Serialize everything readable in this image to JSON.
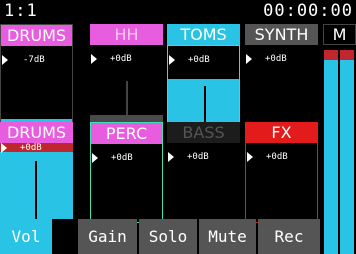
{
  "header": {
    "position": "1:1",
    "time": "00:00:00"
  },
  "tracks_row1": [
    {
      "name": "DRUMS",
      "color": "#e85ce0",
      "level": "-7dB",
      "fill_fraction": 0.0,
      "has_meter": true
    },
    {
      "name": "HH",
      "color": "#e85ce0",
      "level": "+0dB",
      "fill_fraction": 0.0
    },
    {
      "name": "TOMS",
      "color": "#29c4e5",
      "level": "+0dB",
      "fill_fraction": 0.56
    },
    {
      "name": "SYNTH",
      "color": "#555555",
      "level": "+0dB",
      "fill_fraction": 0.0
    }
  ],
  "tracks_row2": [
    {
      "name": "DRUMS",
      "color": "#e85ce0",
      "level": "+0dB",
      "fill_fraction": 0.7
    },
    {
      "name": "PERC",
      "color": "#e85ce0",
      "level": "+0dB",
      "fill_fraction": 0.0
    },
    {
      "name": "BASS",
      "color": "#222222",
      "text_color": "#555555",
      "level": "+0dB",
      "fill_fraction": 0.0
    },
    {
      "name": "FX",
      "color": "#e41b1b",
      "level": "+0dB",
      "fill_fraction": 0.0
    }
  ],
  "master": {
    "label": "M"
  },
  "tabs": [
    "Vol",
    "Gain",
    "Solo",
    "Mute",
    "Rec"
  ],
  "active_tab": "Vol"
}
